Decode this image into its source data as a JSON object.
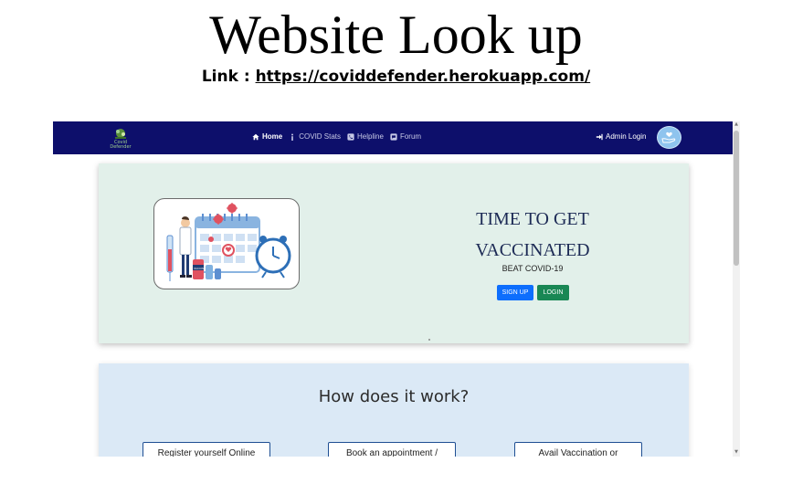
{
  "slide": {
    "title": "Website Look up",
    "link_prefix": "Link :",
    "link_url": "https://coviddefender.herokuapp.com/"
  },
  "navbar": {
    "logo_text": "Covid Defender",
    "links": [
      {
        "label": "Home",
        "icon": "home-icon",
        "active": true
      },
      {
        "label": "COVID Stats",
        "icon": "info-icon",
        "active": false
      },
      {
        "label": "Helpline",
        "icon": "phone-icon",
        "active": false
      },
      {
        "label": "Forum",
        "icon": "forum-icon",
        "active": false
      }
    ],
    "admin_login": "Admin Login",
    "background": "#0d0f6b"
  },
  "hero": {
    "title_line1": "TIME TO GET",
    "title_line2": "VACCINATED",
    "subtitle": "BEAT COVID-19",
    "signup_label": "SIGN UP",
    "login_label": "LOGIN",
    "image_label": "VACCINE"
  },
  "how": {
    "title": "How does it work?",
    "steps": [
      "Register yourself Online",
      "Book an appointment /",
      "Avail Vaccination or"
    ]
  },
  "colors": {
    "primary_button": "#0d6efd",
    "success_button": "#198754",
    "hero_bg": "#e2f0ea",
    "how_bg": "#dbe9f6"
  }
}
